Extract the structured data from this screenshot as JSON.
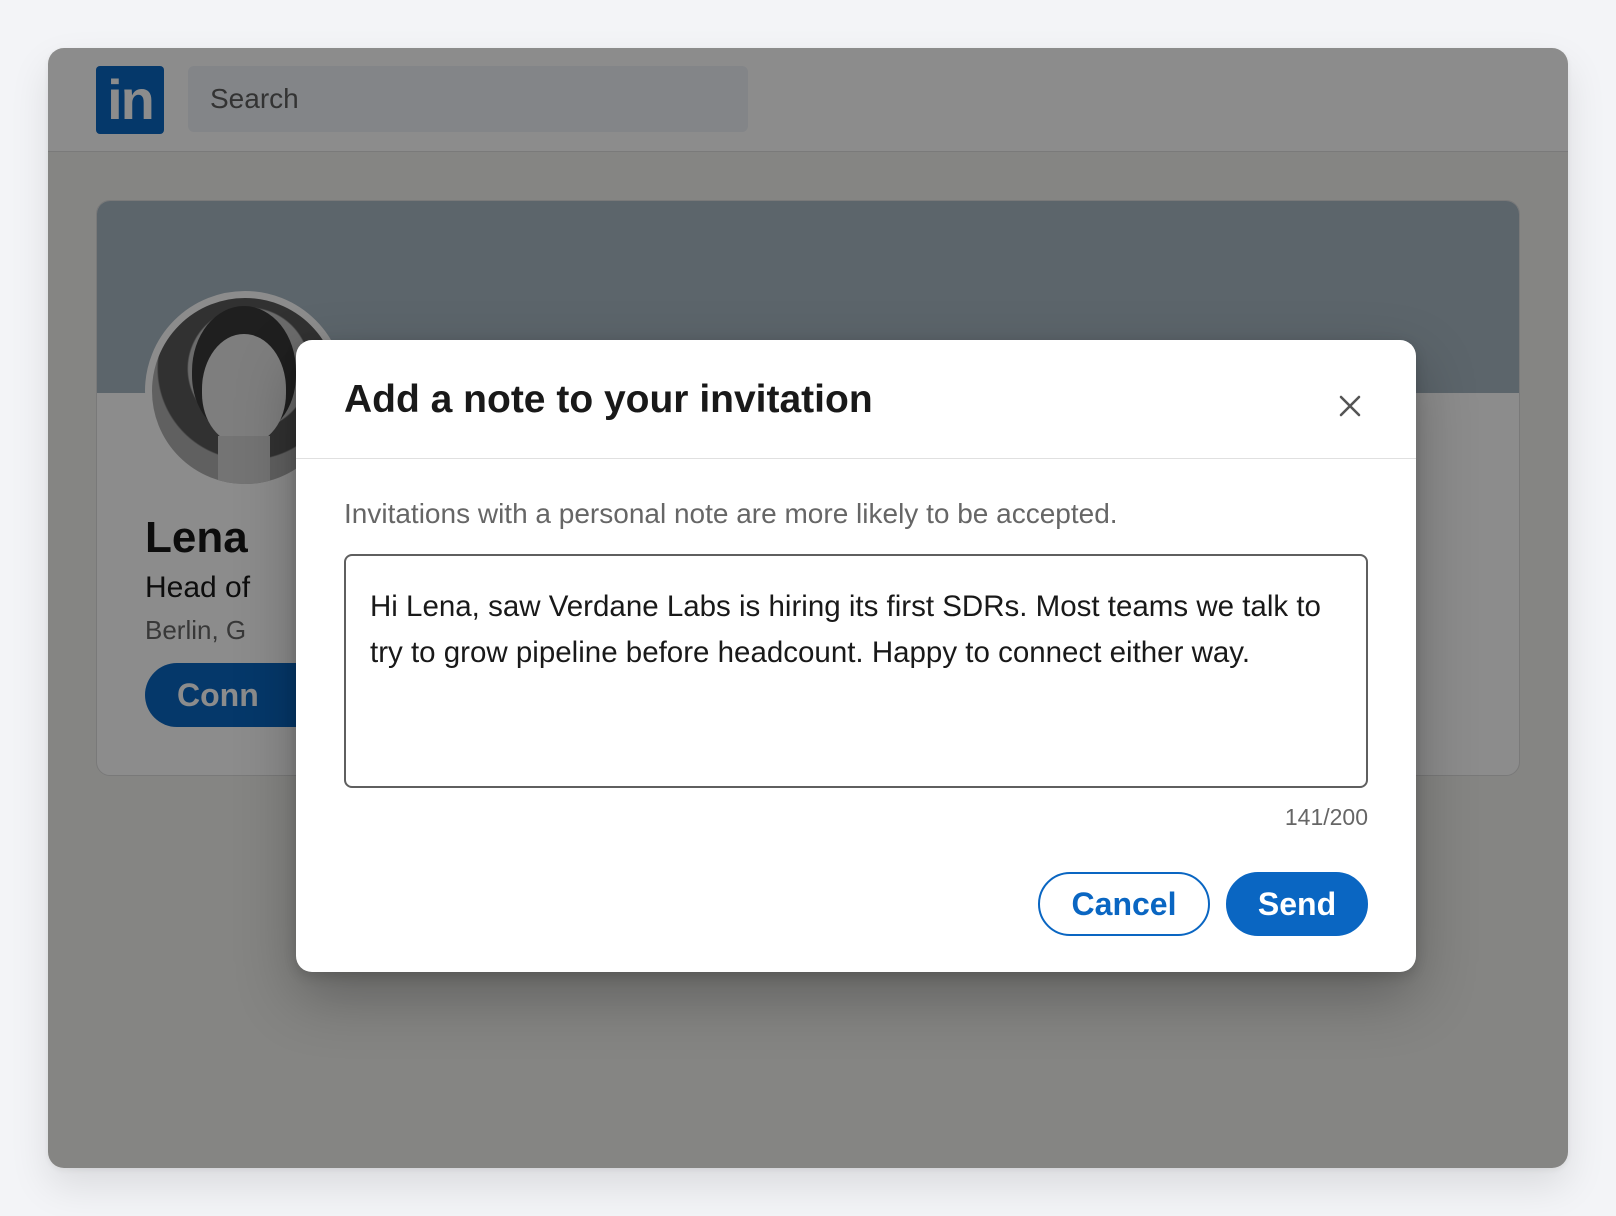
{
  "app": {
    "logo_text": "in",
    "search": {
      "placeholder": "Search"
    },
    "brand_color": "#0a66c2"
  },
  "profile": {
    "name": "Lena",
    "headline": "Head of",
    "location": "Berlin, G",
    "connect_label": "Conn"
  },
  "modal": {
    "title": "Add a note to your invitation",
    "close_icon": "close-icon",
    "hint": "Invitations with a personal note are more likely to be accepted.",
    "note": "Hi Lena, saw Verdane Labs is hiring its first SDRs. Most teams we talk to try to grow pipeline before headcount. Happy to connect either way.",
    "char_count": "141/200",
    "cancel_label": "Cancel",
    "send_label": "Send"
  }
}
